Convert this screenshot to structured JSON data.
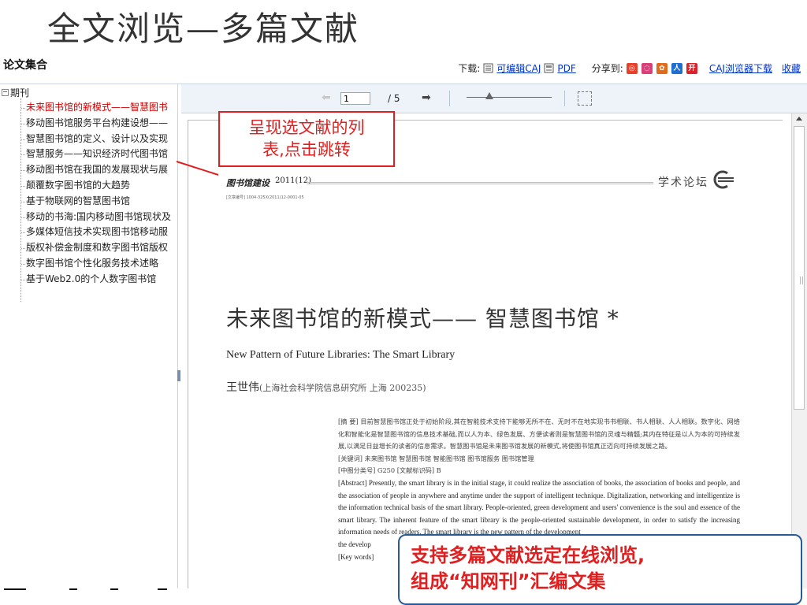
{
  "slide": {
    "title": "全文浏览—多篇文献"
  },
  "header": {
    "app_name": "论文集合",
    "download_label": "下载:",
    "editable_caj_label": "可编辑CAJ",
    "pdf_label": "PDF",
    "share_label": "分享到:",
    "caj_browser_label": "CAJ浏览器下载",
    "favorite_label": "收藏"
  },
  "sidebar": {
    "root_label": "期刊",
    "items": [
      {
        "label": "未来图书馆的新模式——智慧图书",
        "active": true
      },
      {
        "label": "移动图书馆服务平台构建设想——"
      },
      {
        "label": "智慧图书馆的定义、设计以及实现"
      },
      {
        "label": "智慧服务——知识经济时代图书馆"
      },
      {
        "label": "移动图书馆在我国的发展现状与展"
      },
      {
        "label": "颠覆数字图书馆的大趋势"
      },
      {
        "label": "基于物联网的智慧图书馆"
      },
      {
        "label": "移动的书海:国内移动图书馆现状及"
      },
      {
        "label": "多媒体短信技术实现图书馆移动服"
      },
      {
        "label": "版权补偿金制度和数字图书馆版权"
      },
      {
        "label": "数字图书馆个性化服务技术述略"
      },
      {
        "label": "基于Web2.0的个人数字图书馆"
      }
    ]
  },
  "viewer": {
    "current_page": "1",
    "total_pages": "/ 5",
    "zoom_fraction": 0.22
  },
  "document": {
    "journal_name": "图书馆建设",
    "journal_issue": "2011(12)",
    "section_name": "学术论坛",
    "article_no": "[文章编号] 1004-325X(2011)12-0001-05",
    "title_cn": "未来图书馆的新模式—— 智慧图书馆 *",
    "title_en": "New Pattern of Future Libraries: The Smart Library",
    "author": "王世伟",
    "affiliation": "(上海社会科学院信息研究所  上海  200235)",
    "abstract_cn": "[摘  要]  目前智慧图书馆正处于初始阶段,其在智能技术支持下能够无所不在、无时不在地实现书书相联、书人相联、人人相联。数字化、网络化和智能化是智慧图书馆的信息技术基础,而以人为本、绿色发展、方便读者则是智慧图书馆的灵魂与精髓;其内在特征是以人为本的可持续发展,以满足日益增长的读者的信息需求。智慧图书馆是未来图书馆发展的新模式,将使图书馆真正迈向可持续发展之路。",
    "keywords_cn": "[关键词]  未来图书馆   智慧图书馆   智能图书馆   图书馆服务   图书馆管理",
    "classification": "[中图分类号]  G250        [文献标识码]  B",
    "abstract_en": "[Abstract]  Presently, the smart library is in the initial stage, it could realize the association of books, the association of books and people, and the association of people in anywhere and anytime under the support of intelligent technique. Digitalization, networking and intelligentize is the information technical basis of the smart library. People-oriented, green development and users' convenience is the soul and essence of the smart library. The inherent feature of the smart library is the people-oriented sustainable development, in order to satisfy the increasing information needs of readers. The smart library is the new pattern of the development",
    "abstract_en_tail": "the develop",
    "keywords_en": "[Key words]"
  },
  "callouts": {
    "list_note_line1": "呈现选文献的列",
    "list_note_line2": "表,点击跳转",
    "feature_line1": "支持多篇文献选定在线浏览,",
    "feature_line2": "组成“知网刊”汇编文集"
  },
  "colors": {
    "accent_red": "#e02020",
    "active_item": "#cc0000",
    "link_blue": "#0033cc",
    "callout_border": "#2a5a96"
  }
}
